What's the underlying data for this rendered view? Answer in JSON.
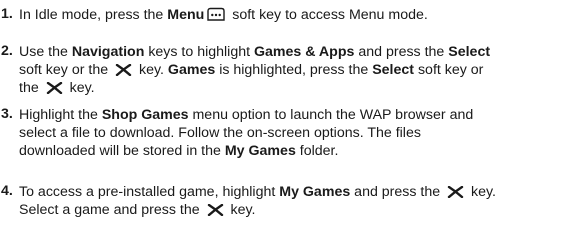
{
  "steps": [
    {
      "number": "1.",
      "lines": [
        {
          "a": "In Idle mode, press the ",
          "b": "Menu",
          "c": " soft key to access Menu mode."
        }
      ]
    },
    {
      "number": "2.",
      "lines": [
        {
          "a": "Use the ",
          "b1": "Navigation",
          "c": " keys to highlight ",
          "b2": "Games & Apps",
          "d": " and press the ",
          "b3": "Select"
        },
        {
          "a": "soft key or the ",
          "b": " key. ",
          "b1": "Games",
          "c": " is highlighted, press the ",
          "b2": "Select",
          "d": " soft key or"
        },
        {
          "a": "the ",
          "b": " key."
        }
      ]
    },
    {
      "number": "3.",
      "lines": [
        {
          "a": "Highlight the ",
          "b": "Shop Games",
          "c": " menu option to launch the WAP browser and"
        },
        {
          "a": "select a file to download. Follow the on-screen options. The files"
        },
        {
          "a": "downloaded will be stored in the ",
          "b": "My Games",
          "c": " folder."
        }
      ]
    },
    {
      "number": "4.",
      "lines": [
        {
          "a": "To access a pre-installed game, highlight ",
          "b": "My Games",
          "c": " and press the ",
          "d": " key."
        },
        {
          "a": "Select a game and press the ",
          "b": " key."
        }
      ]
    }
  ],
  "icons": {
    "menu_softkey": "menu-softkey-icon",
    "select_key": "x-key-icon"
  }
}
